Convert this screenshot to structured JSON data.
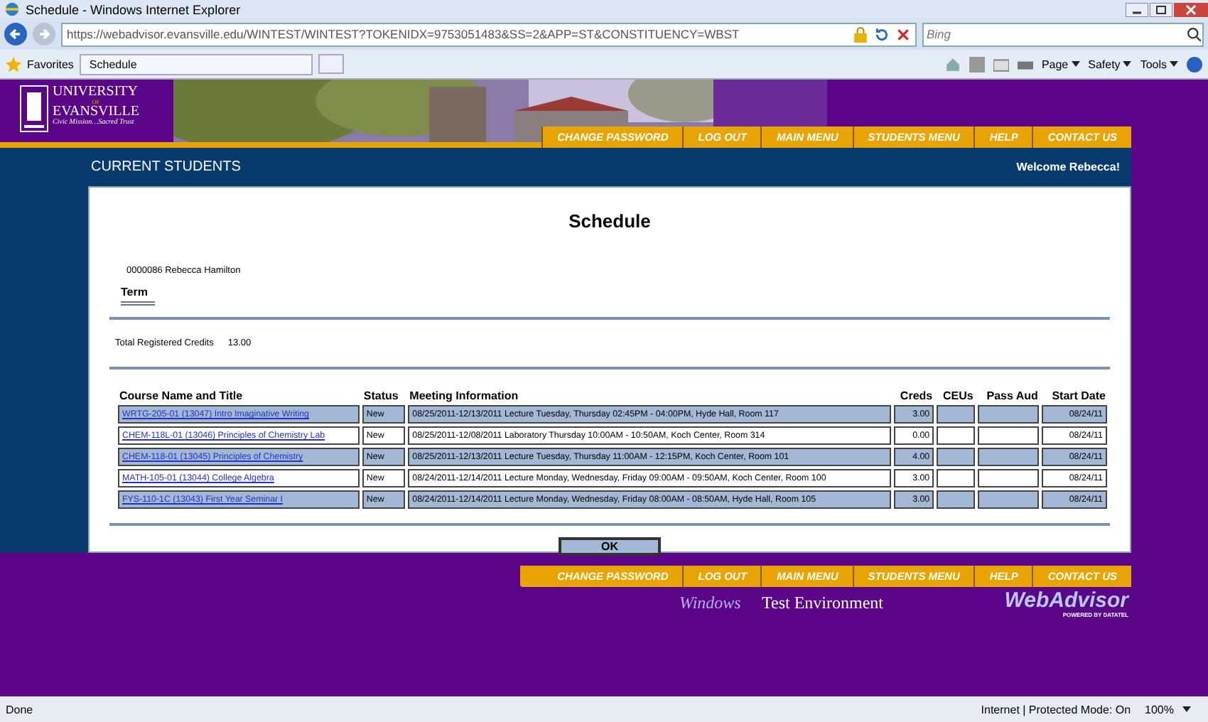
{
  "browser": {
    "title": "Schedule - Windows Internet Explorer",
    "url": "https://webadvisor.evansville.edu/WINTEST/WINTEST?TOKENIDX=9753051483&SS=2&APP=ST&CONSTITUENCY=WBST",
    "search_placeholder": "Bing",
    "favorites": "Favorites",
    "tab": "Schedule",
    "menus": [
      "Page",
      "Safety",
      "Tools"
    ],
    "status": "Done",
    "zone": "Internet | Protected Mode: On",
    "zoom": "100%"
  },
  "header": {
    "logo": {
      "line1": "UNIVERSITY",
      "line2": "OF",
      "line3": "EVANSVILLE",
      "tagline": "Civic Mission…Sacred Trust"
    },
    "nav": [
      "CHANGE PASSWORD",
      "LOG OUT",
      "MAIN MENU",
      "STUDENTS MENU",
      "HELP",
      "CONTACT US"
    ],
    "section": "CURRENT STUDENTS",
    "welcome": "Welcome Rebecca!"
  },
  "content": {
    "title": "Schedule",
    "student": "0000086 Rebecca Hamilton",
    "term_label": "Term",
    "credits_label": "Total Registered Credits",
    "credits_value": "13.00",
    "table": {
      "columns": [
        "Course Name and Title",
        "Status",
        "Meeting Information",
        "Creds",
        "CEUs",
        "Pass Aud",
        "Start Date"
      ],
      "rows": [
        {
          "course": "WRTG-205-01 (13047) Intro Imaginative Writing",
          "status": "New",
          "meeting": "08/25/2011-12/13/2011 Lecture Tuesday, Thursday 02:45PM - 04:00PM, Hyde Hall, Room 117",
          "creds": "3.00",
          "start": "08/24/11"
        },
        {
          "course": "CHEM-118L-01 (13046) Principles of Chemistry Lab",
          "status": "New",
          "meeting": "08/25/2011-12/08/2011 Laboratory Thursday 10:00AM - 10:50AM, Koch Center, Room 314",
          "creds": "0.00",
          "start": "08/24/11"
        },
        {
          "course": "CHEM-118-01 (13045) Principles of Chemistry",
          "status": "New",
          "meeting": "08/25/2011-12/13/2011 Lecture Tuesday, Thursday 11:00AM - 12:15PM, Koch Center, Room 101",
          "creds": "4.00",
          "start": "08/24/11"
        },
        {
          "course": "MATH-105-01 (13044) College Algebra",
          "status": "New",
          "meeting": "08/24/2011-12/14/2011 Lecture Monday, Wednesday, Friday 09:00AM - 09:50AM, Koch Center, Room 100",
          "creds": "3.00",
          "start": "08/24/11"
        },
        {
          "course": "FYS-110-1C (13043) First Year Seminar I",
          "status": "New",
          "meeting": "08/24/2011-12/14/2011 Lecture Monday, Wednesday, Friday 08:00AM - 08:50AM, Hyde Hall, Room 105",
          "creds": "3.00",
          "start": "08/24/11"
        }
      ]
    },
    "button": "OK"
  },
  "footer": {
    "nav": [
      "CHANGE PASSWORD",
      "LOG OUT",
      "MAIN MENU",
      "STUDENTS MENU",
      "HELP",
      "CONTACT US"
    ],
    "os": "Windows",
    "environment": "Test Environment",
    "brand": "WebAdvisor",
    "brand_sub": "POWERED BY DATATEL"
  }
}
